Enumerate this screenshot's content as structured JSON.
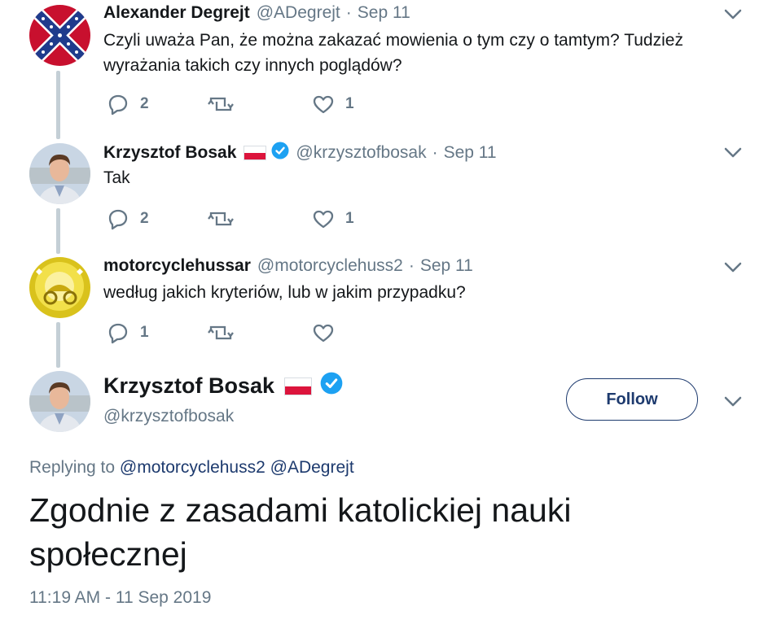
{
  "tweets": [
    {
      "name": "Alexander Degrejt",
      "handle": "@ADegrejt",
      "date": "Sep 11",
      "text": "Czyli uważa Pan, że można zakazać mowienia o tym czy o tamtym? Tudzież wyrażania takich czy innych poglądów?",
      "replies": "2",
      "retweets": "",
      "likes": "1"
    },
    {
      "name": "Krzysztof Bosak",
      "handle": "@krzysztofbosak",
      "date": "Sep 11",
      "text": "Tak",
      "replies": "2",
      "retweets": "",
      "likes": "1"
    },
    {
      "name": "motorcyclehussar",
      "handle": "@motorcyclehuss2",
      "date": "Sep 11",
      "text": "według jakich kryteriów, lub w jakim przypadku?",
      "replies": "1",
      "retweets": "",
      "likes": ""
    }
  ],
  "main_tweet": {
    "name": "Krzysztof Bosak",
    "handle": "@krzysztofbosak",
    "follow_label": "Follow",
    "replying_prefix": "Replying to",
    "replying_to": [
      "@motorcyclehuss2",
      "@ADegrejt"
    ],
    "text": "Zgodnie z zasadami katolickiej nauki społecznej",
    "timestamp": "11:19 AM - 11 Sep 2019"
  },
  "ui": {
    "separator": "·",
    "colors": {
      "text": "#14171a",
      "secondary": "#657786",
      "verified": "#1da1f2",
      "thread_line": "#c4cfd6",
      "follow_border": "#1d3a6e",
      "flag_red": "#dc143c"
    },
    "icons": [
      "reply-icon",
      "retweet-icon",
      "like-icon",
      "chevron-down-icon",
      "verified-badge-icon",
      "poland-flag-icon"
    ]
  }
}
